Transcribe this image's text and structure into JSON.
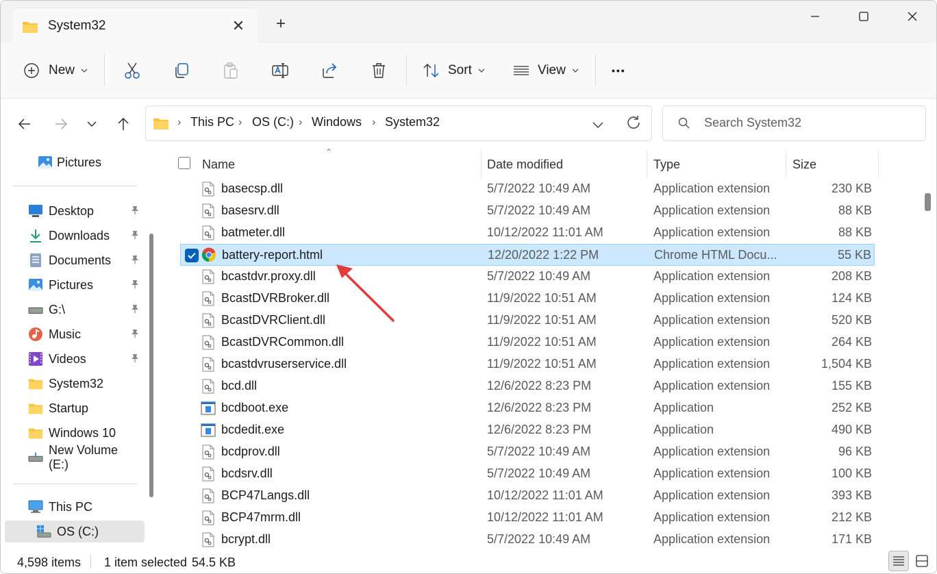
{
  "window": {
    "tab_title": "System32",
    "new_tab_glyph": "+",
    "close_tab_glyph": "✕"
  },
  "toolbar": {
    "new_label": "New",
    "sort_label": "Sort",
    "view_label": "View",
    "more_glyph": "•••"
  },
  "address": {
    "crumbs": [
      "This PC",
      "OS (C:)",
      "Windows",
      "System32"
    ]
  },
  "search": {
    "placeholder": "Search System32"
  },
  "sidebar": {
    "top_item": "Pictures",
    "quick_access": [
      {
        "label": "Desktop",
        "icon": "desktop-icon",
        "pinned": true
      },
      {
        "label": "Downloads",
        "icon": "download-icon",
        "pinned": true
      },
      {
        "label": "Documents",
        "icon": "documents-icon",
        "pinned": true
      },
      {
        "label": "Pictures",
        "icon": "pictures-icon",
        "pinned": true
      },
      {
        "label": "G:\\",
        "icon": "drive-icon",
        "pinned": true
      },
      {
        "label": "Music",
        "icon": "music-icon",
        "pinned": true
      },
      {
        "label": "Videos",
        "icon": "videos-icon",
        "pinned": true
      },
      {
        "label": "System32",
        "icon": "folder-icon",
        "pinned": false
      },
      {
        "label": "Startup",
        "icon": "folder-icon",
        "pinned": false
      },
      {
        "label": "Windows 10",
        "icon": "folder-icon",
        "pinned": false
      },
      {
        "label": "New Volume (E:)",
        "icon": "network-drive-icon",
        "pinned": false
      }
    ],
    "this_pc": "This PC",
    "os_drive": "OS (C:)"
  },
  "columns": {
    "name": "Name",
    "date": "Date modified",
    "type": "Type",
    "size": "Size"
  },
  "files": [
    {
      "name": "basecsp.dll",
      "date": "5/7/2022 10:49 AM",
      "type": "Application extension",
      "size": "230 KB",
      "icon": "dll-icon"
    },
    {
      "name": "basesrv.dll",
      "date": "5/7/2022 10:49 AM",
      "type": "Application extension",
      "size": "88 KB",
      "icon": "dll-icon"
    },
    {
      "name": "batmeter.dll",
      "date": "10/12/2022 11:01 AM",
      "type": "Application extension",
      "size": "88 KB",
      "icon": "dll-icon"
    },
    {
      "name": "battery-report.html",
      "date": "12/20/2022 1:22 PM",
      "type": "Chrome HTML Docu...",
      "size": "55 KB",
      "icon": "chrome-icon",
      "selected": true
    },
    {
      "name": "bcastdvr.proxy.dll",
      "date": "5/7/2022 10:49 AM",
      "type": "Application extension",
      "size": "208 KB",
      "icon": "dll-icon"
    },
    {
      "name": "BcastDVRBroker.dll",
      "date": "11/9/2022 10:51 AM",
      "type": "Application extension",
      "size": "124 KB",
      "icon": "dll-icon"
    },
    {
      "name": "BcastDVRClient.dll",
      "date": "11/9/2022 10:51 AM",
      "type": "Application extension",
      "size": "520 KB",
      "icon": "dll-icon"
    },
    {
      "name": "BcastDVRCommon.dll",
      "date": "11/9/2022 10:51 AM",
      "type": "Application extension",
      "size": "264 KB",
      "icon": "dll-icon"
    },
    {
      "name": "bcastdvruserservice.dll",
      "date": "11/9/2022 10:51 AM",
      "type": "Application extension",
      "size": "1,504 KB",
      "icon": "dll-icon"
    },
    {
      "name": "bcd.dll",
      "date": "12/6/2022 8:23 PM",
      "type": "Application extension",
      "size": "155 KB",
      "icon": "dll-icon"
    },
    {
      "name": "bcdboot.exe",
      "date": "12/6/2022 8:23 PM",
      "type": "Application",
      "size": "252 KB",
      "icon": "exe-icon"
    },
    {
      "name": "bcdedit.exe",
      "date": "12/6/2022 8:23 PM",
      "type": "Application",
      "size": "490 KB",
      "icon": "exe-icon"
    },
    {
      "name": "bcdprov.dll",
      "date": "5/7/2022 10:49 AM",
      "type": "Application extension",
      "size": "96 KB",
      "icon": "dll-icon"
    },
    {
      "name": "bcdsrv.dll",
      "date": "5/7/2022 10:49 AM",
      "type": "Application extension",
      "size": "100 KB",
      "icon": "dll-icon"
    },
    {
      "name": "BCP47Langs.dll",
      "date": "10/12/2022 11:01 AM",
      "type": "Application extension",
      "size": "393 KB",
      "icon": "dll-icon"
    },
    {
      "name": "BCP47mrm.dll",
      "date": "10/12/2022 11:01 AM",
      "type": "Application extension",
      "size": "212 KB",
      "icon": "dll-icon"
    },
    {
      "name": "bcrypt.dll",
      "date": "5/7/2022 10:49 AM",
      "type": "Application extension",
      "size": "171 KB",
      "icon": "dll-icon"
    }
  ],
  "status": {
    "items_count": "4,598 items",
    "selected": "1 item selected",
    "selected_size": "54.5 KB"
  },
  "colors": {
    "accent": "#005fb8",
    "selection": "#cce8ff",
    "folder": "#f8c440",
    "annotation_arrow": "#e03c3c"
  }
}
